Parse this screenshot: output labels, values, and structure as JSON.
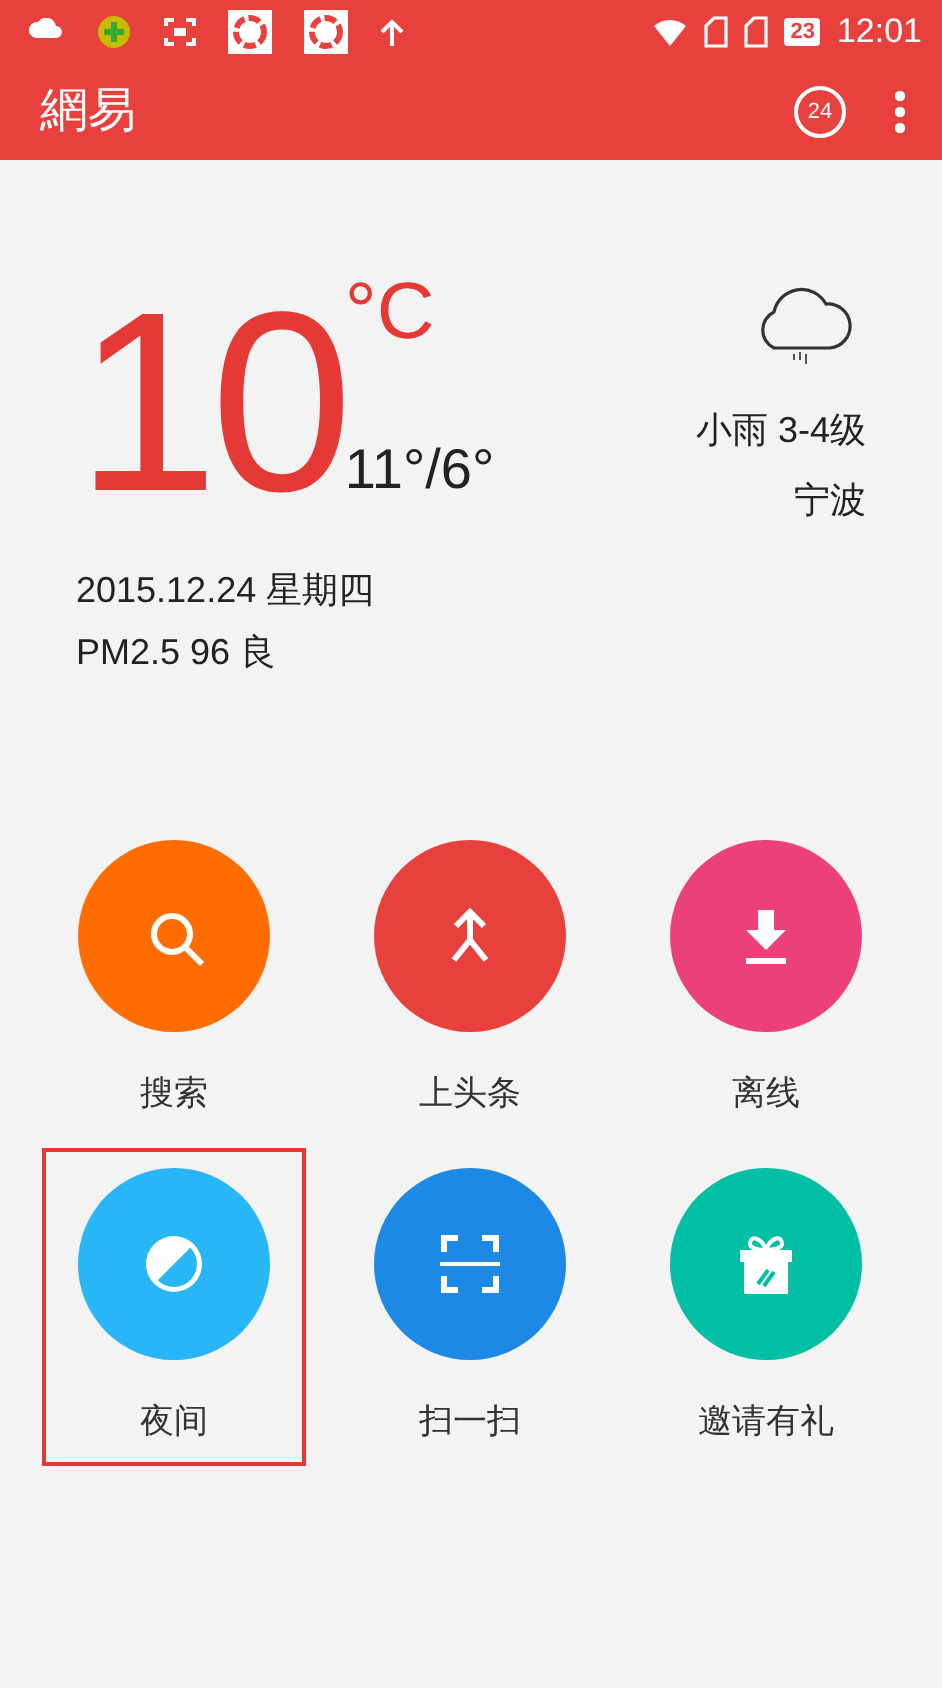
{
  "status_bar": {
    "battery": "23",
    "time": "12:01"
  },
  "app_bar": {
    "logo": "網易",
    "badge": "24"
  },
  "weather": {
    "temperature": "10",
    "unit": "°C",
    "range": "11°/6°",
    "condition": "小雨 3-4级",
    "city": "宁波",
    "date": "2015.12.24 星期四",
    "air": "PM2.5 96 良"
  },
  "actions": [
    {
      "label": "搜索",
      "kind": "search",
      "color": "#ff6d00",
      "highlighted": false
    },
    {
      "label": "上头条",
      "kind": "merge",
      "color": "#e8403c",
      "highlighted": false
    },
    {
      "label": "离线",
      "kind": "download",
      "color": "#ec407a",
      "highlighted": false
    },
    {
      "label": "夜间",
      "kind": "night",
      "color": "#29b6f6",
      "highlighted": true
    },
    {
      "label": "扫一扫",
      "kind": "scan",
      "color": "#1e88e5",
      "highlighted": false
    },
    {
      "label": "邀请有礼",
      "kind": "gift",
      "color": "#00bfa5",
      "highlighted": false
    }
  ]
}
